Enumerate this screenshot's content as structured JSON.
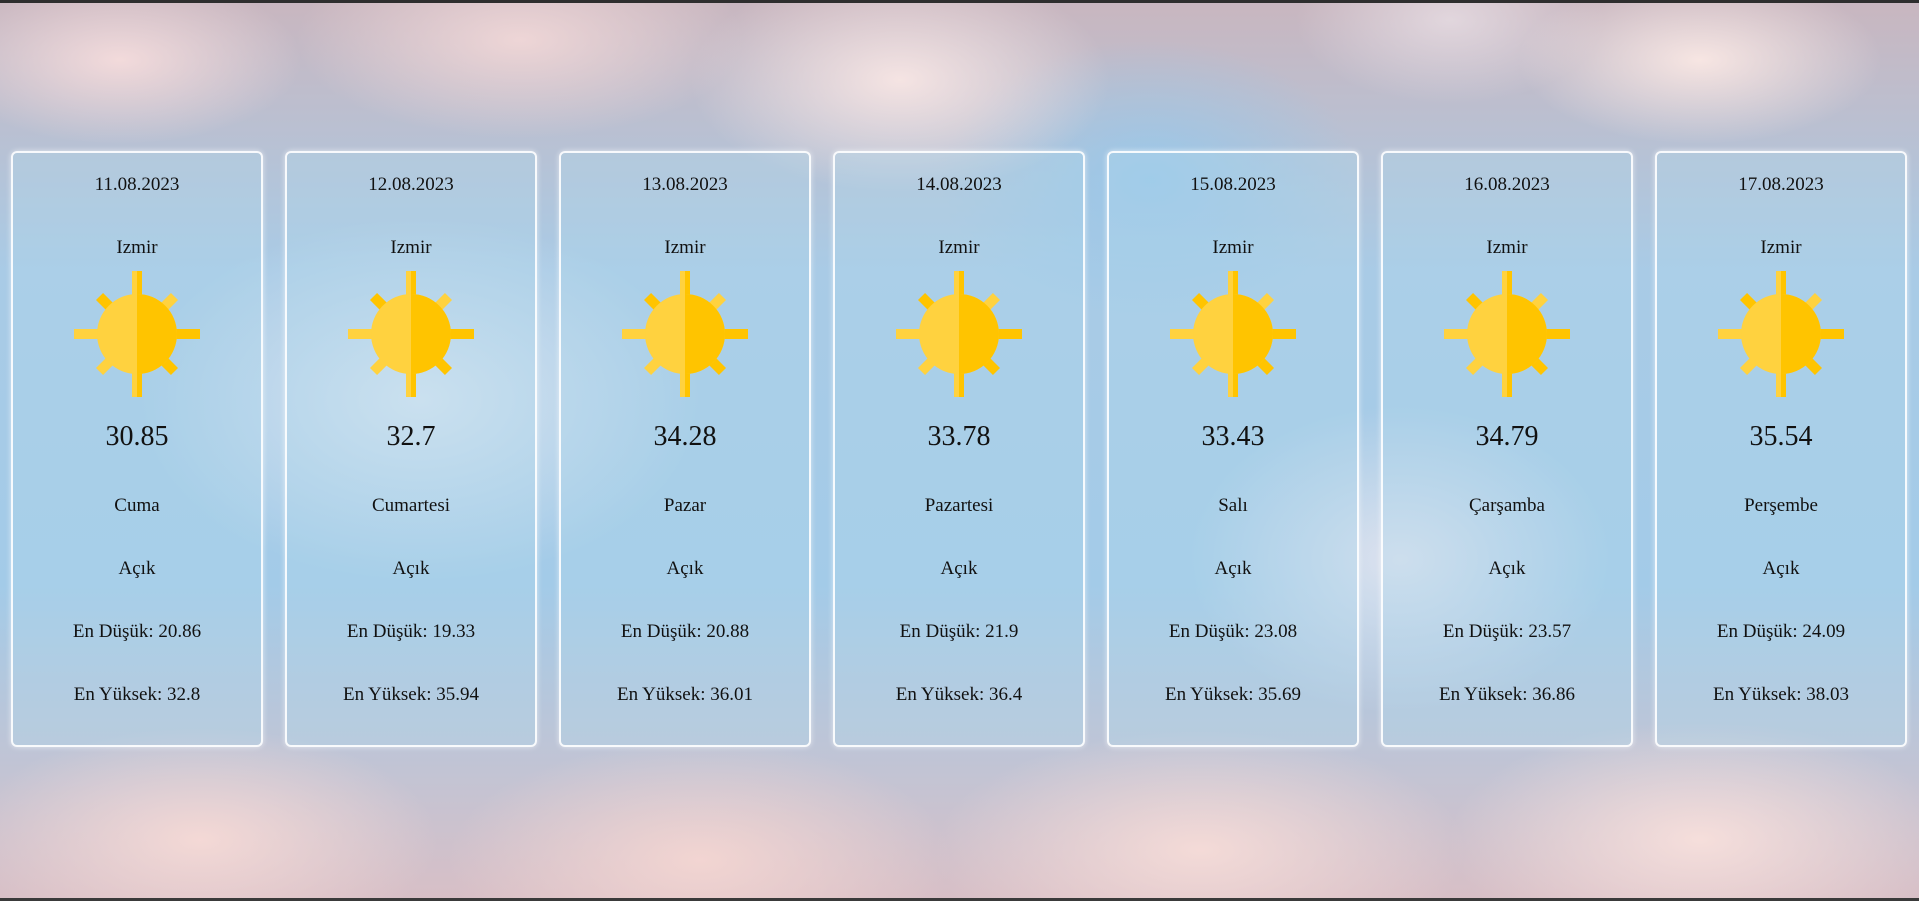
{
  "colors": {
    "sun_light": "#ffd23f",
    "sun_dark": "#ffc400",
    "card_border": "#ffffff"
  },
  "forecast": [
    {
      "date": "11.08.2023",
      "city": "Izmir",
      "icon": "sun-icon",
      "temp": "30.85",
      "day": "Cuma",
      "condition": "Açık",
      "low": "En Düşük: 20.86",
      "high": "En Yüksek: 32.8"
    },
    {
      "date": "12.08.2023",
      "city": "Izmir",
      "icon": "sun-icon",
      "temp": "32.7",
      "day": "Cumartesi",
      "condition": "Açık",
      "low": "En Düşük: 19.33",
      "high": "En Yüksek: 35.94"
    },
    {
      "date": "13.08.2023",
      "city": "Izmir",
      "icon": "sun-icon",
      "temp": "34.28",
      "day": "Pazar",
      "condition": "Açık",
      "low": "En Düşük: 20.88",
      "high": "En Yüksek: 36.01"
    },
    {
      "date": "14.08.2023",
      "city": "Izmir",
      "icon": "sun-icon",
      "temp": "33.78",
      "day": "Pazartesi",
      "condition": "Açık",
      "low": "En Düşük: 21.9",
      "high": "En Yüksek: 36.4"
    },
    {
      "date": "15.08.2023",
      "city": "Izmir",
      "icon": "sun-icon",
      "temp": "33.43",
      "day": "Salı",
      "condition": "Açık",
      "low": "En Düşük: 23.08",
      "high": "En Yüksek: 35.69"
    },
    {
      "date": "16.08.2023",
      "city": "Izmir",
      "icon": "sun-icon",
      "temp": "34.79",
      "day": "Çarşamba",
      "condition": "Açık",
      "low": "En Düşük: 23.57",
      "high": "En Yüksek: 36.86"
    },
    {
      "date": "17.08.2023",
      "city": "Izmir",
      "icon": "sun-icon",
      "temp": "35.54",
      "day": "Perşembe",
      "condition": "Açık",
      "low": "En Düşük: 24.09",
      "high": "En Yüksek: 38.03"
    }
  ]
}
